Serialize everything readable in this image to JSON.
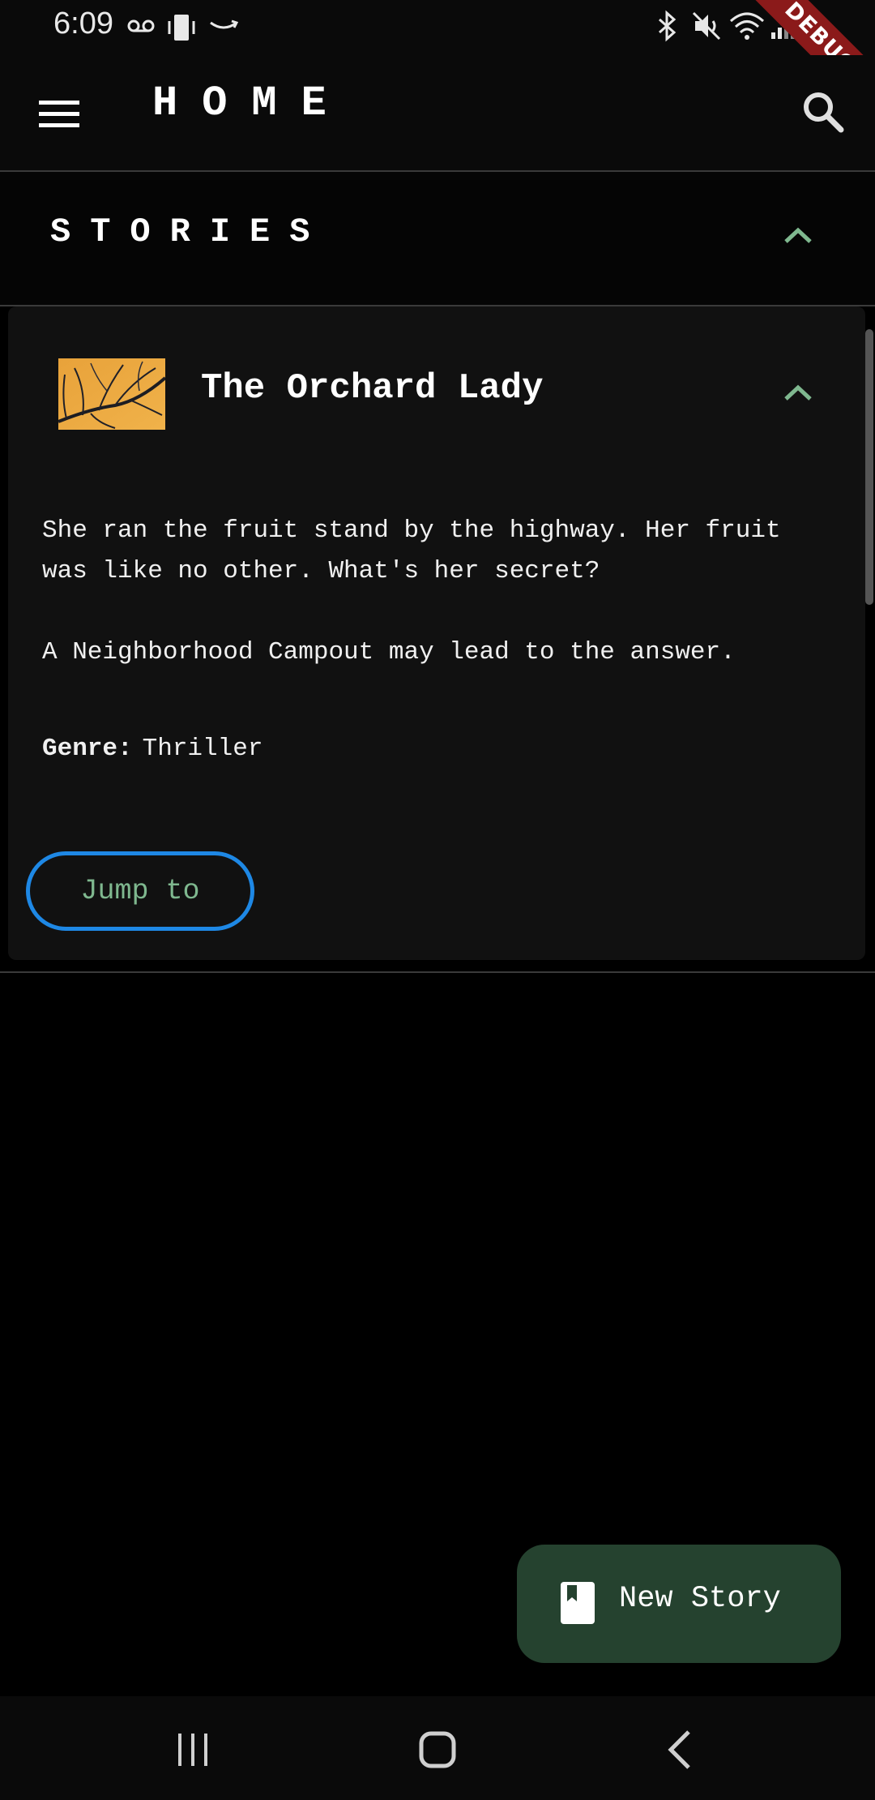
{
  "status_bar": {
    "time": "6:09",
    "left_icons": [
      "voicemail-icon",
      "vibrate-phone-icon",
      "amazon-icon"
    ],
    "right_icons": [
      "bluetooth-icon",
      "mute-icon",
      "wifi-icon",
      "signal-icon",
      "battery-icon"
    ],
    "debug_label": "DEBUG"
  },
  "app_bar": {
    "title": "HOME",
    "menu_icon": "hamburger-menu-icon",
    "search_icon": "search-icon"
  },
  "section": {
    "title": "STORIES",
    "expanded": true
  },
  "story": {
    "title": "The Orchard Lady",
    "paragraph_1": "She ran the fruit stand by the highway. Her fruit was like no other. What's her secret?",
    "paragraph_2": "A Neighborhood Campout may lead to the answer.",
    "genre_label": "Genre:",
    "genre_value": "Thriller",
    "jump_label": "Jump to",
    "expanded": true
  },
  "fab": {
    "label": "New Story",
    "icon": "book-icon"
  },
  "colors": {
    "accent_green": "#7fb88f",
    "fab_background": "#25422f",
    "button_border": "#1e88e5",
    "debug_ribbon": "#8b1a1a"
  },
  "nav_bar": {
    "items": [
      "recent-apps-icon",
      "home-icon",
      "back-icon"
    ]
  }
}
